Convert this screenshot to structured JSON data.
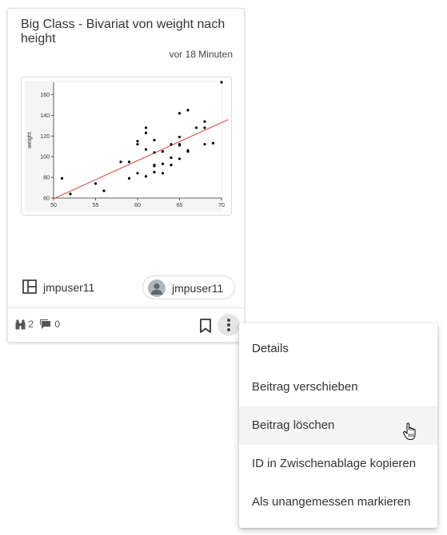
{
  "card": {
    "title": "Big Class - Bivariat von weight nach height",
    "time": "vor 18 Minuten",
    "group_name": "jmpuser11",
    "user_name": "jmpuser11",
    "views": "2",
    "comments": "0"
  },
  "chart_data": {
    "type": "scatter",
    "title": "",
    "xlabel": "",
    "ylabel": "weight",
    "xlim": [
      50,
      70
    ],
    "ylim": [
      60,
      172
    ],
    "x_ticks": [
      "50",
      "55",
      "60",
      "65",
      "70"
    ],
    "y_ticks": [
      "60",
      "80",
      "100",
      "120",
      "140",
      "160"
    ],
    "points": [
      [
        51,
        79
      ],
      [
        52,
        64
      ],
      [
        55,
        74
      ],
      [
        56,
        67
      ],
      [
        58,
        95
      ],
      [
        59,
        79
      ],
      [
        59,
        95
      ],
      [
        60,
        84
      ],
      [
        60,
        112
      ],
      [
        60,
        115
      ],
      [
        61,
        81
      ],
      [
        61,
        107
      ],
      [
        61,
        123
      ],
      [
        61,
        128
      ],
      [
        62,
        85
      ],
      [
        62,
        91
      ],
      [
        62,
        92
      ],
      [
        62,
        104
      ],
      [
        62,
        116
      ],
      [
        63,
        84
      ],
      [
        63,
        93
      ],
      [
        63,
        105
      ],
      [
        64,
        92
      ],
      [
        64,
        99
      ],
      [
        64,
        112
      ],
      [
        65,
        98
      ],
      [
        65,
        111
      ],
      [
        65,
        112
      ],
      [
        65,
        119
      ],
      [
        65,
        142
      ],
      [
        66,
        105
      ],
      [
        66,
        106
      ],
      [
        66,
        145
      ],
      [
        67,
        128
      ],
      [
        68,
        112
      ],
      [
        68,
        128
      ],
      [
        68,
        134
      ],
      [
        69,
        113
      ],
      [
        70,
        172
      ]
    ],
    "fit_line": {
      "x": [
        50,
        70.8
      ],
      "y": [
        59.3,
        135.9
      ],
      "color": "#e05050"
    },
    "point_color": "#000000",
    "grid": false
  },
  "menu": {
    "items": [
      {
        "label": "Details"
      },
      {
        "label": "Beitrag verschieben"
      },
      {
        "label": "Beitrag löschen"
      },
      {
        "label": "ID in Zwischenablage kopieren"
      },
      {
        "label": "Als unangemessen markieren"
      }
    ],
    "hovered_index": 2
  },
  "icons": {
    "group": "layout-icon",
    "views": "binoculars-icon",
    "comments": "comment-icon",
    "bookmark": "bookmark-icon",
    "more": "more-vertical-icon",
    "avatar": "person-icon",
    "cursor": "hand-pointer-icon"
  }
}
